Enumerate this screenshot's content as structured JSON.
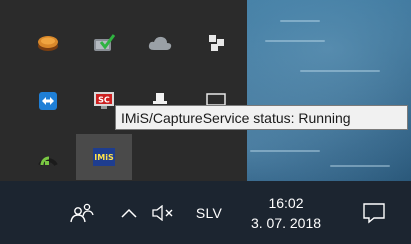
{
  "tooltip": {
    "text": "IMiS/CaptureService status: Running"
  },
  "overflow_icons": [
    {
      "name": "orange-disc-app-icon"
    },
    {
      "name": "security-check-icon"
    },
    {
      "name": "cloud-icon"
    },
    {
      "name": "dropbox-icon"
    },
    {
      "name": "teamviewer-icon"
    },
    {
      "name": "screen-capture-sc-icon",
      "label": "SC"
    },
    {
      "name": "usb-device-icon"
    },
    {
      "name": "monitor-display-icon"
    },
    {
      "name": "green-half-circle-icon"
    },
    {
      "name": "imis-capture-service-icon",
      "label": "IMiS"
    }
  ],
  "taskbar": {
    "language": "SLV",
    "time": "16:02",
    "date": "3. 07. 2018"
  },
  "colors": {
    "flyout_bg": "#2b2b2b",
    "taskbar_bg": "#1c2530",
    "tooltip_bg": "#f1f1f1",
    "active_icon_bg": "#4a4a4a"
  }
}
